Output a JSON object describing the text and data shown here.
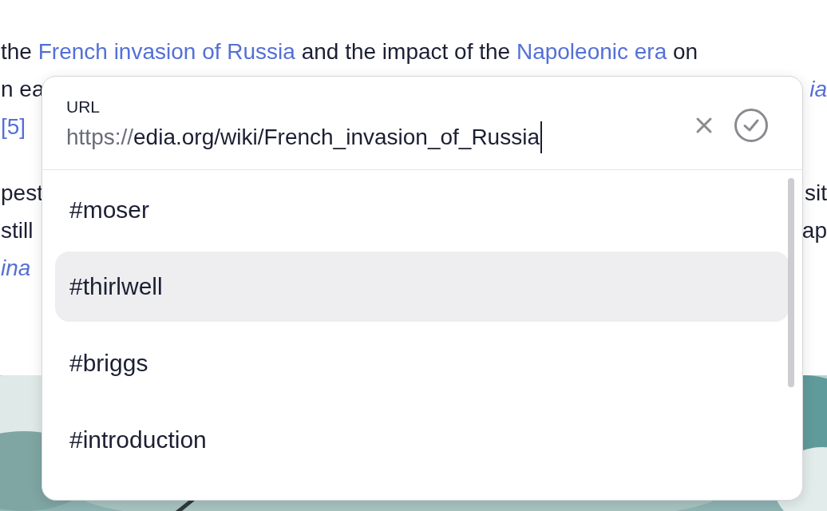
{
  "article": {
    "paragraphs": [
      {
        "lines": [
          {
            "left": [
              {
                "text": "the ",
                "kind": "plain"
              },
              {
                "text": "French invasion of Russia",
                "kind": "link"
              },
              {
                "text": " and the impact of the ",
                "kind": "plain"
              },
              {
                "text": "Napoleonic era",
                "kind": "link"
              },
              {
                "text": " on",
                "kind": "plain"
              }
            ]
          },
          {
            "left": [
              {
                "text": "n ea",
                "kind": "plain"
              }
            ],
            "right": [
              {
                "text": "ia",
                "kind": "italic-link"
              }
            ]
          },
          {
            "left": [
              {
                "text": "[5]",
                "kind": "link"
              }
            ]
          }
        ]
      },
      {
        "lines": [
          {
            "left": [
              {
                "text": "pest",
                "kind": "plain"
              }
            ],
            "right": [
              {
                "text": "sit",
                "kind": "plain"
              }
            ]
          },
          {
            "left": [
              {
                "text": "still",
                "kind": "plain"
              }
            ],
            "right": [
              {
                "text": "ap",
                "kind": "plain"
              }
            ]
          },
          {
            "left": [
              {
                "text": "ina",
                "kind": "italic-link"
              }
            ]
          }
        ]
      }
    ]
  },
  "url_popover": {
    "field": {
      "label": "URL",
      "prefix": "https://",
      "value": "edia.org/wiki/French_invasion_of_Russia"
    },
    "anchors": [
      {
        "label": "#moser",
        "selected": false
      },
      {
        "label": "#thirlwell",
        "selected": true
      },
      {
        "label": "#briggs",
        "selected": false
      },
      {
        "label": "#introduction",
        "selected": false
      }
    ]
  }
}
